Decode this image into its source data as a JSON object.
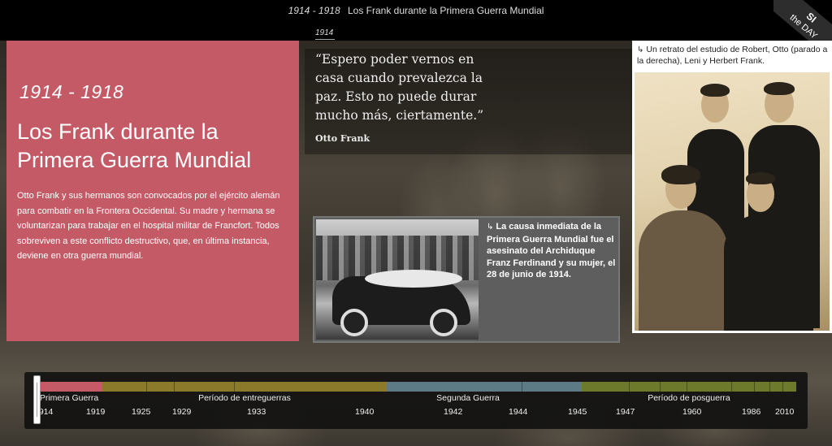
{
  "header": {
    "years": "1914 - 1918",
    "title": "Los Frank durante la Primera Guerra Mundial"
  },
  "badge": {
    "line1": "SI",
    "line2": "the DAY"
  },
  "intro": {
    "years": "1914 - 1918",
    "title": "Los Frank durante la Primera Guerra Mundial",
    "body": "Otto Frank y sus hermanos son convocados por el ejército alemán para combatir en la Frontera Occidental. Su madre y hermana se voluntarizan para trabajar en el hospital militar de Francfort. Todos sobreviven a este conflicto destructivo, que, en última instancia, deviene en otra guerra mundial."
  },
  "quote": {
    "year": "1914",
    "text": "“Espero poder vernos en casa cuando prevalezca la paz. Esto no puede durar mucho más, ciertamente.”",
    "author": "Otto Frank"
  },
  "photo_mid": {
    "caption": "La causa inmediata de la Primera Guerra Mundial fue el asesinato del Archiduque Franz Ferdinand y su mujer, el 28 de junio de 1914."
  },
  "photo_right": {
    "caption": "Un retrato del estudio de Robert, Otto (parado a la derecha), Leni y Herbert Frank."
  },
  "timeline": {
    "eras": [
      {
        "label": "Primera Guerra",
        "color": "#c45a66"
      },
      {
        "label": "Período de entreguerras",
        "color": "#8c7a2b"
      },
      {
        "label": "Segunda Guerra",
        "color": "#5d7b85"
      },
      {
        "label": "Período de posguerra",
        "color": "#6d7a2c"
      }
    ],
    "years": [
      "1914",
      "1919",
      "1925",
      "1929",
      "1933",
      "1940",
      "1942",
      "1944",
      "1945",
      "1947",
      "1960",
      "1986",
      "2010"
    ]
  }
}
